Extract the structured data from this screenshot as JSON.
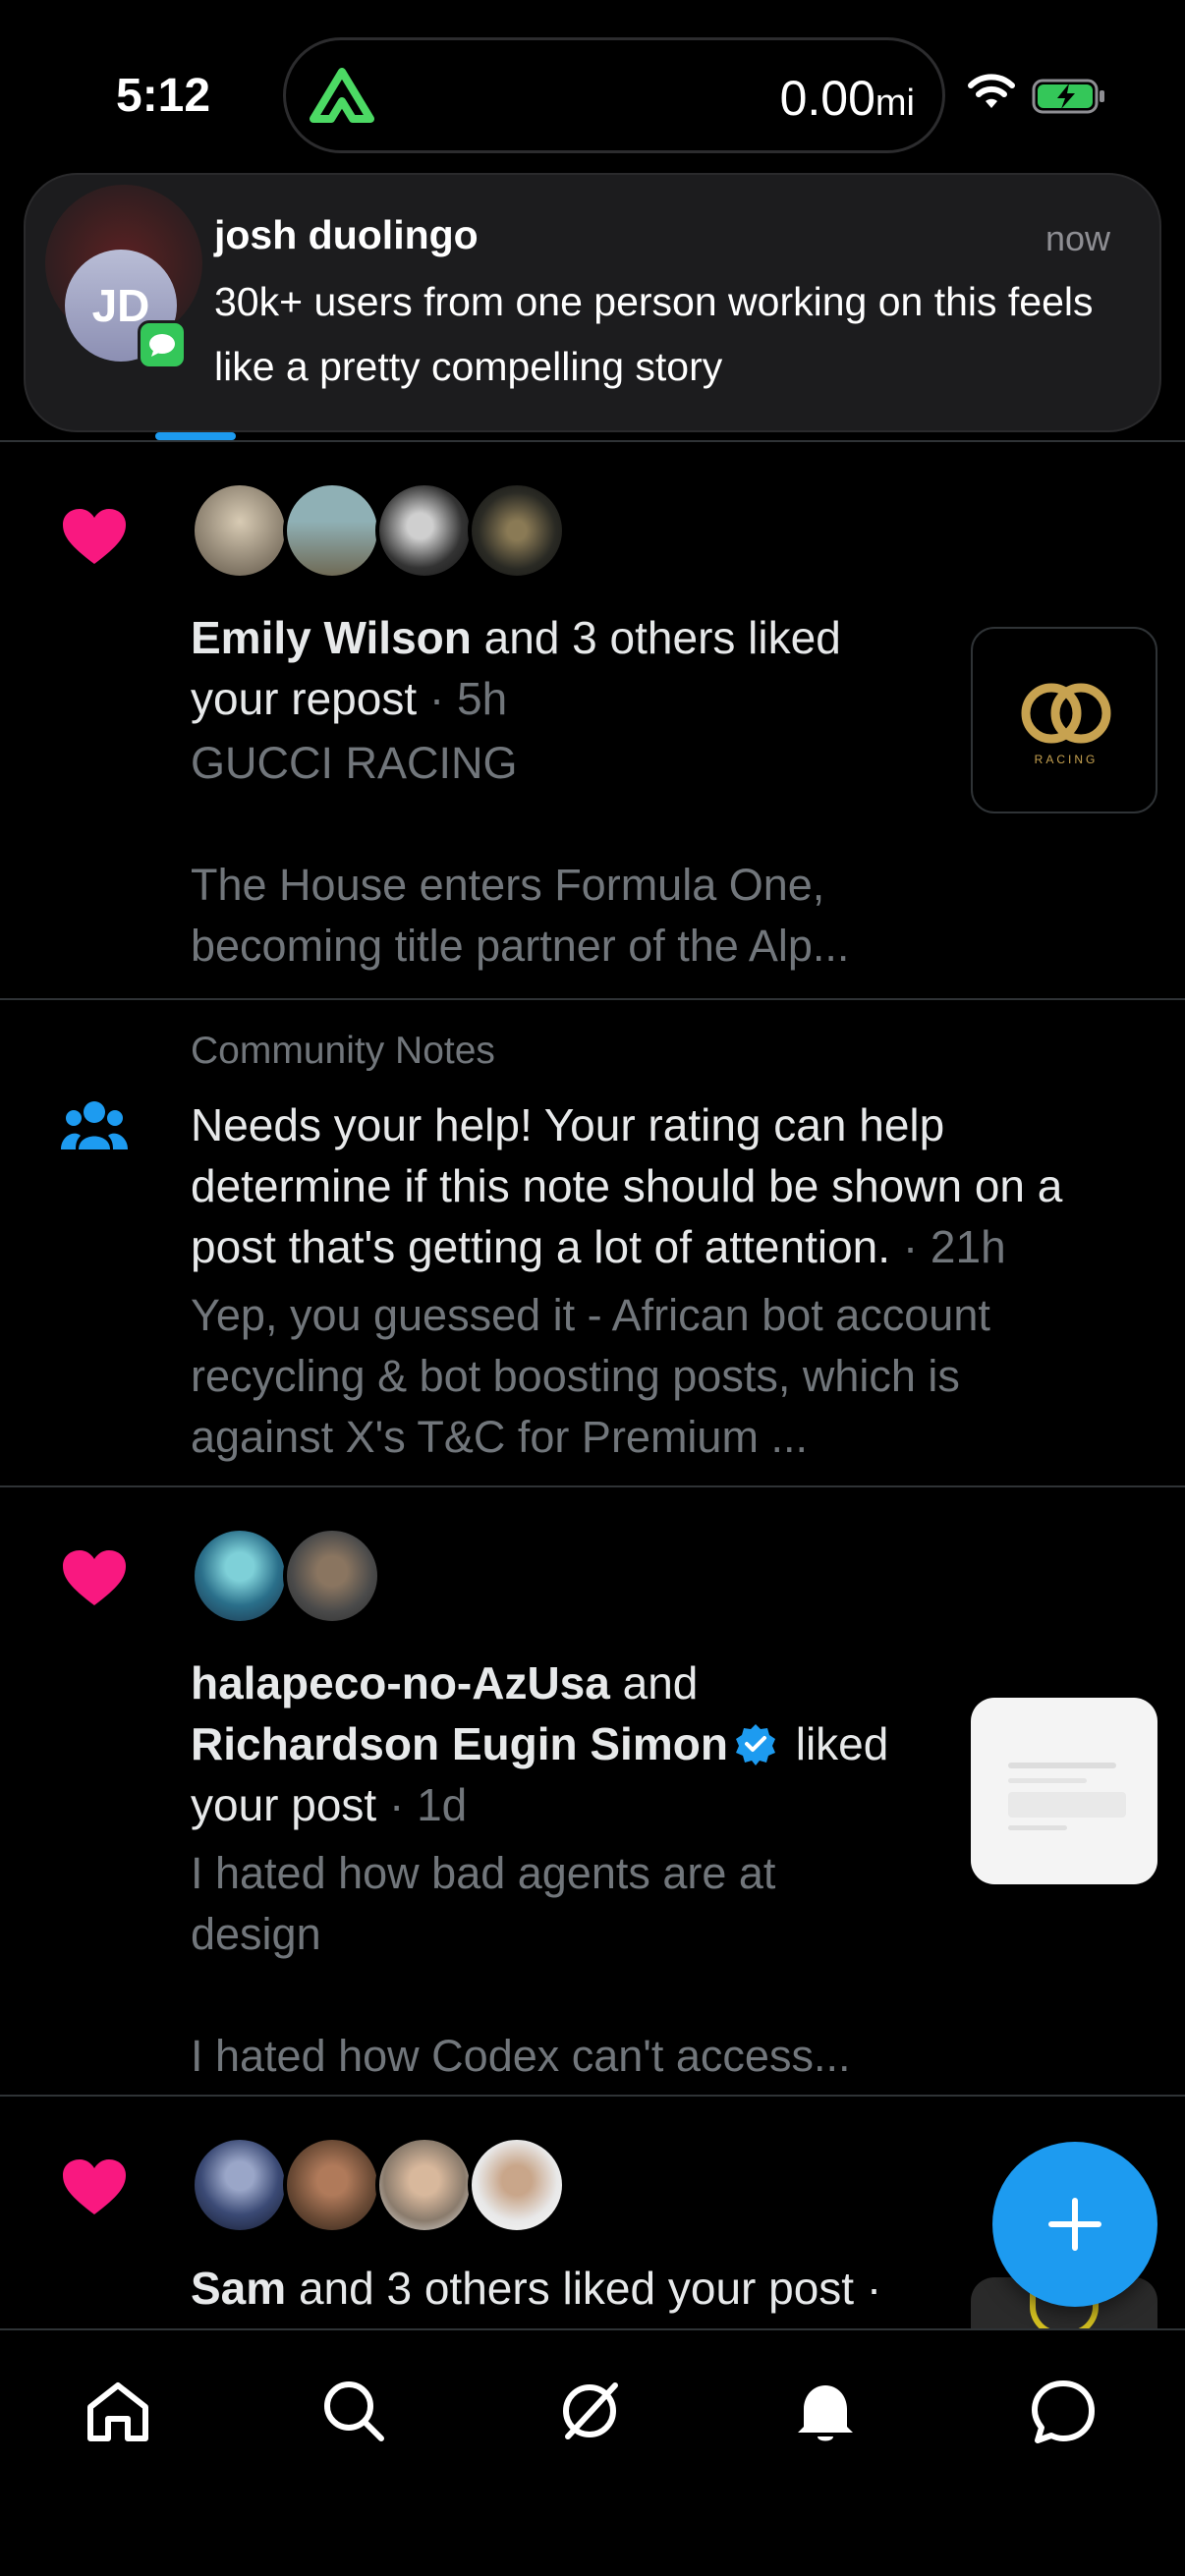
{
  "status_bar": {
    "time": "5:12",
    "distance_value": "0.00",
    "distance_unit": "mi"
  },
  "notification": {
    "avatar_initials": "JD",
    "sender": "josh  duolingo",
    "time": "now",
    "body": "30k+ users from one person working on this feels like a pretty compelling story"
  },
  "feed": {
    "items": [
      {
        "icon": "heart-icon",
        "actor": "Emily Wilson",
        "action": " and 3 others liked your repost",
        "time": " · 5h",
        "preview_line1": "GUCCI RACING",
        "preview_line2": "The House enters Formula One,",
        "preview_line3": "becoming title partner of the Alp...",
        "thumb_text": "RACING"
      },
      {
        "icon": "community-notes-icon",
        "label": "Community Notes",
        "text_line1": "Needs your help! Your rating can help",
        "text_line2": "determine if this note should be shown on a",
        "text_line3": "post that's getting a lot of attention.",
        "time": " · 21h",
        "preview_line1": "Yep, you guessed it - African bot account",
        "preview_line2": "recycling & bot boosting posts, which is",
        "preview_line3": "against X's T&C for Premium ..."
      },
      {
        "icon": "heart-icon",
        "actor1": "halapeco-no-AzUsa",
        "joiner": " and",
        "actor2": "Richardson Eugin Simon",
        "action": " liked",
        "action2": "your post",
        "time": " · 1d",
        "preview_line1": "I hated how bad agents are at",
        "preview_line2": "design",
        "preview_line3": "I hated how Codex can't access..."
      },
      {
        "icon": "heart-icon",
        "actor": "Sam",
        "action": " and 3 others liked your post ·"
      }
    ]
  },
  "colors": {
    "accent": "#1d9bf0",
    "like": "#f91880",
    "muted": "#71767b",
    "background": "#000000"
  },
  "bottom_nav": [
    "home-icon",
    "search-icon",
    "grok-icon",
    "notifications-icon",
    "messages-icon"
  ]
}
